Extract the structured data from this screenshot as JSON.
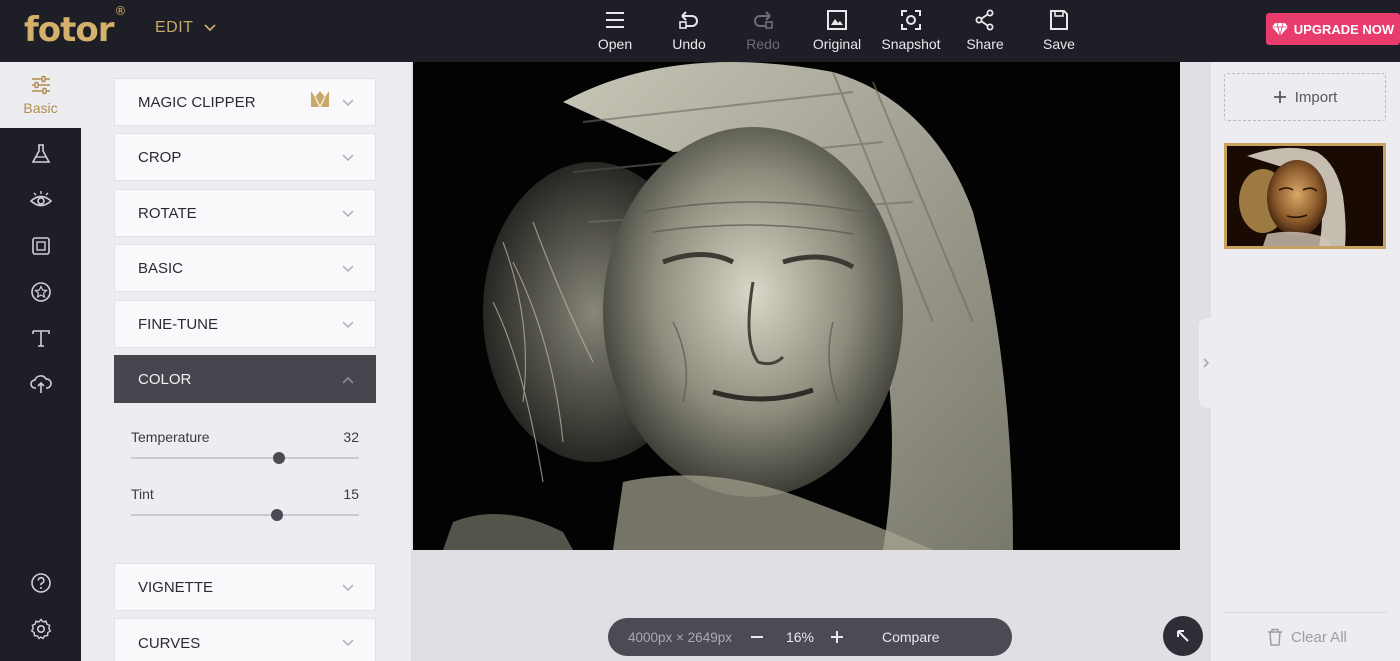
{
  "brand": {
    "logo_text": "fotor",
    "logo_mark": "®",
    "color": "#d4b06a"
  },
  "edit_menu": {
    "label": "EDIT",
    "icon": "chevron-down-icon"
  },
  "toolbar": [
    {
      "label": "Open",
      "icon": "menu-icon",
      "enabled": true
    },
    {
      "label": "Undo",
      "icon": "undo-icon",
      "enabled": true
    },
    {
      "label": "Redo",
      "icon": "redo-icon",
      "enabled": false
    },
    {
      "label": "Original",
      "icon": "image-icon",
      "enabled": true
    },
    {
      "label": "Snapshot",
      "icon": "snapshot-icon",
      "enabled": true
    },
    {
      "label": "Share",
      "icon": "share-icon",
      "enabled": true
    },
    {
      "label": "Save",
      "icon": "save-icon",
      "enabled": true
    }
  ],
  "upgrade": {
    "label": "UPGRADE NOW",
    "icon": "diamond-icon",
    "color": "#e73c6c"
  },
  "rail": {
    "active": {
      "label": "Basic",
      "icon": "sliders-icon"
    },
    "items": [
      "flask-icon",
      "eye-icon",
      "frame-icon",
      "star-icon",
      "text-icon",
      "cloud-upload-icon"
    ],
    "bottom": [
      "help-icon",
      "settings-icon"
    ]
  },
  "panel": {
    "sections": [
      {
        "label": "MAGIC CLIPPER",
        "premium": true
      },
      {
        "label": "CROP"
      },
      {
        "label": "ROTATE"
      },
      {
        "label": "BASIC"
      },
      {
        "label": "FINE-TUNE"
      },
      {
        "label": "COLOR",
        "expanded": true
      }
    ],
    "sliders": [
      {
        "label": "Temperature",
        "value": "32",
        "fraction": 0.65
      },
      {
        "label": "Tint",
        "value": "15",
        "fraction": 0.64
      }
    ],
    "lower_sections": [
      {
        "label": "VIGNETTE"
      },
      {
        "label": "CURVES"
      }
    ]
  },
  "statusbar": {
    "dimensions": "4000px × 2649px",
    "zoom_out": "minus-icon",
    "zoom": "16%",
    "zoom_in": "plus-icon",
    "compare": "Compare"
  },
  "right_panel": {
    "import_label": "Import",
    "clear_label": "Clear All"
  }
}
